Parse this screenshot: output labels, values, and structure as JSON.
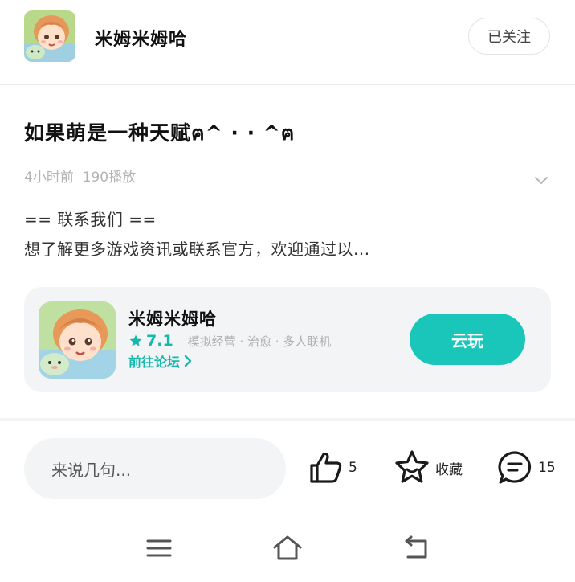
{
  "header": {
    "author_name": "米姆米姆哈",
    "follow_label": "已关注",
    "avatar_icon": "chibi-character-avatar"
  },
  "post": {
    "title": "如果萌是一种天赋ฅ^ · · ^ฅ",
    "time": "4小时前",
    "plays": "190播放",
    "body_line1": "== 联系我们 ==",
    "body_line2": "想了解更多游戏资讯或联系官方，欢迎通过以..."
  },
  "game": {
    "name": "米姆米姆哈",
    "rating": "7.1",
    "tags": "模拟经营 · 治愈 · 多人联机",
    "forum_label": "前往论坛",
    "play_label": "云玩",
    "accent_color": "#19c6b9"
  },
  "actions": {
    "comment_placeholder": "来说几句...",
    "like_count": "5",
    "favorite_label": "收藏",
    "comment_count": "15"
  },
  "system_nav": {
    "icons": [
      "menu-icon",
      "home-icon",
      "back-icon"
    ]
  }
}
